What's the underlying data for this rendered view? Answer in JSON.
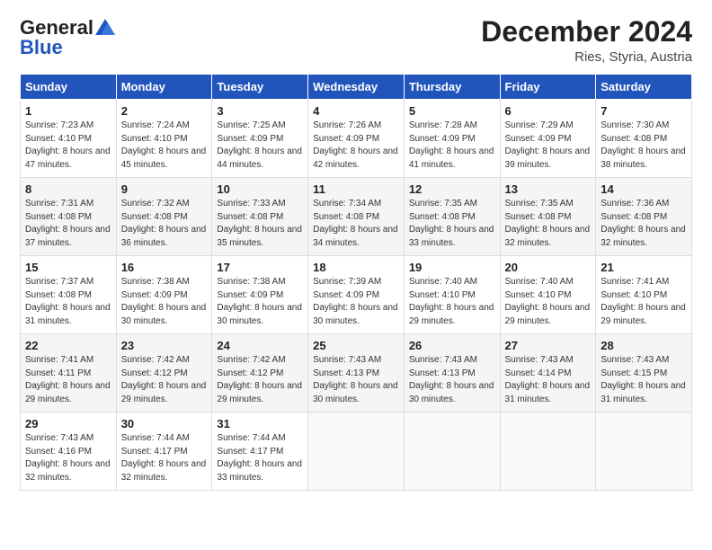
{
  "logo": {
    "line1": "General",
    "line2": "Blue"
  },
  "title": "December 2024",
  "subtitle": "Ries, Styria, Austria",
  "days_of_week": [
    "Sunday",
    "Monday",
    "Tuesday",
    "Wednesday",
    "Thursday",
    "Friday",
    "Saturday"
  ],
  "weeks": [
    [
      {
        "day": "1",
        "sunrise": "7:23 AM",
        "sunset": "4:10 PM",
        "daylight": "8 hours and 47 minutes."
      },
      {
        "day": "2",
        "sunrise": "7:24 AM",
        "sunset": "4:10 PM",
        "daylight": "8 hours and 45 minutes."
      },
      {
        "day": "3",
        "sunrise": "7:25 AM",
        "sunset": "4:09 PM",
        "daylight": "8 hours and 44 minutes."
      },
      {
        "day": "4",
        "sunrise": "7:26 AM",
        "sunset": "4:09 PM",
        "daylight": "8 hours and 42 minutes."
      },
      {
        "day": "5",
        "sunrise": "7:28 AM",
        "sunset": "4:09 PM",
        "daylight": "8 hours and 41 minutes."
      },
      {
        "day": "6",
        "sunrise": "7:29 AM",
        "sunset": "4:09 PM",
        "daylight": "8 hours and 39 minutes."
      },
      {
        "day": "7",
        "sunrise": "7:30 AM",
        "sunset": "4:08 PM",
        "daylight": "8 hours and 38 minutes."
      }
    ],
    [
      {
        "day": "8",
        "sunrise": "7:31 AM",
        "sunset": "4:08 PM",
        "daylight": "8 hours and 37 minutes."
      },
      {
        "day": "9",
        "sunrise": "7:32 AM",
        "sunset": "4:08 PM",
        "daylight": "8 hours and 36 minutes."
      },
      {
        "day": "10",
        "sunrise": "7:33 AM",
        "sunset": "4:08 PM",
        "daylight": "8 hours and 35 minutes."
      },
      {
        "day": "11",
        "sunrise": "7:34 AM",
        "sunset": "4:08 PM",
        "daylight": "8 hours and 34 minutes."
      },
      {
        "day": "12",
        "sunrise": "7:35 AM",
        "sunset": "4:08 PM",
        "daylight": "8 hours and 33 minutes."
      },
      {
        "day": "13",
        "sunrise": "7:35 AM",
        "sunset": "4:08 PM",
        "daylight": "8 hours and 32 minutes."
      },
      {
        "day": "14",
        "sunrise": "7:36 AM",
        "sunset": "4:08 PM",
        "daylight": "8 hours and 32 minutes."
      }
    ],
    [
      {
        "day": "15",
        "sunrise": "7:37 AM",
        "sunset": "4:08 PM",
        "daylight": "8 hours and 31 minutes."
      },
      {
        "day": "16",
        "sunrise": "7:38 AM",
        "sunset": "4:09 PM",
        "daylight": "8 hours and 30 minutes."
      },
      {
        "day": "17",
        "sunrise": "7:38 AM",
        "sunset": "4:09 PM",
        "daylight": "8 hours and 30 minutes."
      },
      {
        "day": "18",
        "sunrise": "7:39 AM",
        "sunset": "4:09 PM",
        "daylight": "8 hours and 30 minutes."
      },
      {
        "day": "19",
        "sunrise": "7:40 AM",
        "sunset": "4:10 PM",
        "daylight": "8 hours and 29 minutes."
      },
      {
        "day": "20",
        "sunrise": "7:40 AM",
        "sunset": "4:10 PM",
        "daylight": "8 hours and 29 minutes."
      },
      {
        "day": "21",
        "sunrise": "7:41 AM",
        "sunset": "4:10 PM",
        "daylight": "8 hours and 29 minutes."
      }
    ],
    [
      {
        "day": "22",
        "sunrise": "7:41 AM",
        "sunset": "4:11 PM",
        "daylight": "8 hours and 29 minutes."
      },
      {
        "day": "23",
        "sunrise": "7:42 AM",
        "sunset": "4:12 PM",
        "daylight": "8 hours and 29 minutes."
      },
      {
        "day": "24",
        "sunrise": "7:42 AM",
        "sunset": "4:12 PM",
        "daylight": "8 hours and 29 minutes."
      },
      {
        "day": "25",
        "sunrise": "7:43 AM",
        "sunset": "4:13 PM",
        "daylight": "8 hours and 30 minutes."
      },
      {
        "day": "26",
        "sunrise": "7:43 AM",
        "sunset": "4:13 PM",
        "daylight": "8 hours and 30 minutes."
      },
      {
        "day": "27",
        "sunrise": "7:43 AM",
        "sunset": "4:14 PM",
        "daylight": "8 hours and 31 minutes."
      },
      {
        "day": "28",
        "sunrise": "7:43 AM",
        "sunset": "4:15 PM",
        "daylight": "8 hours and 31 minutes."
      }
    ],
    [
      {
        "day": "29",
        "sunrise": "7:43 AM",
        "sunset": "4:16 PM",
        "daylight": "8 hours and 32 minutes."
      },
      {
        "day": "30",
        "sunrise": "7:44 AM",
        "sunset": "4:17 PM",
        "daylight": "8 hours and 32 minutes."
      },
      {
        "day": "31",
        "sunrise": "7:44 AM",
        "sunset": "4:17 PM",
        "daylight": "8 hours and 33 minutes."
      },
      null,
      null,
      null,
      null
    ]
  ]
}
